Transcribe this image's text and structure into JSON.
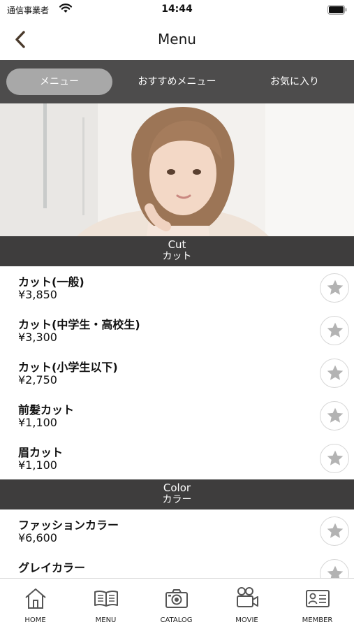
{
  "status_bar": {
    "carrier": "通信事業者",
    "time": "14:44"
  },
  "header": {
    "title": "Menu"
  },
  "tabs": [
    {
      "label": "メニュー",
      "active": true
    },
    {
      "label": "おすすめメニュー",
      "active": false
    },
    {
      "label": "お気に入り",
      "active": false
    }
  ],
  "sections": [
    {
      "title_en": "Cut",
      "title_ja": "カット",
      "items": [
        {
          "name": "カット(一般)",
          "price": "¥3,850"
        },
        {
          "name": "カット(中学生・高校生)",
          "price": "¥3,300"
        },
        {
          "name": "カット(小学生以下)",
          "price": "¥2,750"
        },
        {
          "name": "前髪カット",
          "price": "¥1,100"
        },
        {
          "name": "眉カット",
          "price": "¥1,100"
        }
      ]
    },
    {
      "title_en": "Color",
      "title_ja": "カラー",
      "items": [
        {
          "name": "ファッションカラー",
          "price": "¥6,600"
        },
        {
          "name": "グレイカラー",
          "price": ""
        }
      ]
    }
  ],
  "bottom_nav": [
    {
      "label": "HOME",
      "icon": "home-icon"
    },
    {
      "label": "MENU",
      "icon": "book-icon"
    },
    {
      "label": "CATALOG",
      "icon": "camera-icon"
    },
    {
      "label": "MOVIE",
      "icon": "video-camera-icon"
    },
    {
      "label": "MEMBER",
      "icon": "member-card-icon"
    }
  ],
  "colors": {
    "tab_bar": "#4d4c4c",
    "tab_active": "#a8a8a8",
    "section_header": "#3e3d3d",
    "star": "#b3b3b3"
  }
}
